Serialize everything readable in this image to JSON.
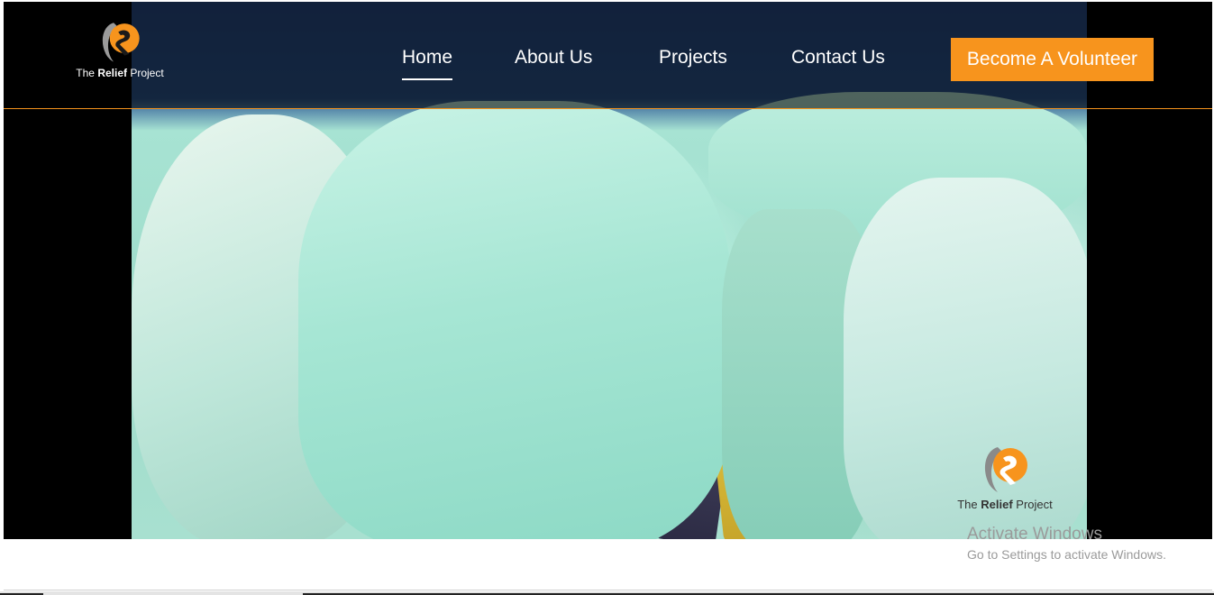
{
  "brand": {
    "name_prefix": "The",
    "name_bold": "Relief",
    "name_suffix": "Project",
    "accent_color": "#f7941d"
  },
  "nav": {
    "items": [
      {
        "label": "Home",
        "active": true
      },
      {
        "label": "About Us",
        "active": false
      },
      {
        "label": "Projects",
        "active": false
      },
      {
        "label": "Contact Us",
        "active": false
      }
    ],
    "cta_label": "Become A Volunteer"
  },
  "hero": {
    "media": "video-frame-relief-bags",
    "watermark": {
      "name_prefix": "The",
      "name_bold": "Relief",
      "name_suffix": "Project"
    }
  },
  "system_overlay": {
    "title": "Activate Windows",
    "subtitle": "Go to Settings to activate Windows."
  }
}
